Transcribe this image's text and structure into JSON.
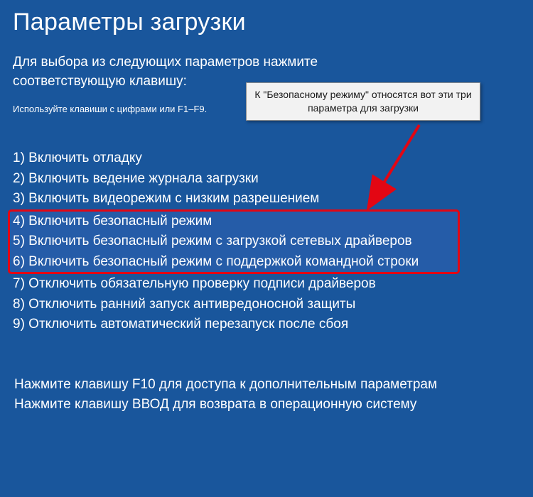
{
  "title": "Параметры загрузки",
  "instruction": "Для выбора из следующих параметров нажмите соответствующую клавишу:",
  "hint": "Используйте клавиши с цифрами или F1–F9.",
  "options": {
    "o1": "1) Включить отладку",
    "o2": "2) Включить ведение журнала загрузки",
    "o3": "3) Включить видеорежим с низким разрешением",
    "o4": "4) Включить безопасный режим",
    "o5": "5) Включить безопасный режим с загрузкой сетевых драйверов",
    "o6": "6) Включить безопасный режим с поддержкой командной строки",
    "o7": "7) Отключить обязательную проверку подписи драйверов",
    "o8": "8) Отключить ранний запуск антивредоносной защиты",
    "o9": "9) Отключить автоматический перезапуск после сбоя"
  },
  "footer": {
    "f10": "Нажмите клавишу F10 для доступа к дополнительным параметрам",
    "enter": "Нажмите клавишу ВВОД для возврата в операционную систему"
  },
  "callout": "К \"Безопасному режиму\" относятся вот эти три параметра для загрузки"
}
